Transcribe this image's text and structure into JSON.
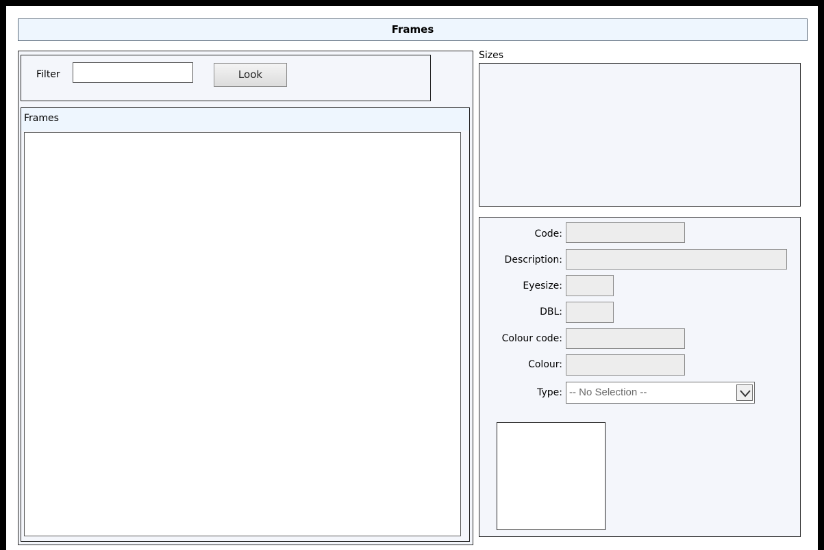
{
  "window": {
    "title": "Frames"
  },
  "filter": {
    "label": "Filter",
    "value": "",
    "button_label": "Look"
  },
  "frames_list": {
    "header": "Frames",
    "items": []
  },
  "sizes": {
    "header": "Sizes"
  },
  "details": {
    "code_label": "Code:",
    "code_value": "",
    "description_label": "Description:",
    "description_value": "",
    "eyesize_label": "Eyesize:",
    "eyesize_value": "",
    "dbl_label": "DBL:",
    "dbl_value": "",
    "colour_code_label": "Colour code:",
    "colour_code_value": "",
    "colour_label": "Colour:",
    "colour_value": "",
    "type_label": "Type:",
    "type_selected": "-- No Selection --"
  },
  "colors": {
    "header_bg": "#eef6fe",
    "panel_bg": "#f4f6fb",
    "readonly_bg": "#ededed"
  },
  "icons": {
    "dropdown": "chevron-down-icon"
  }
}
